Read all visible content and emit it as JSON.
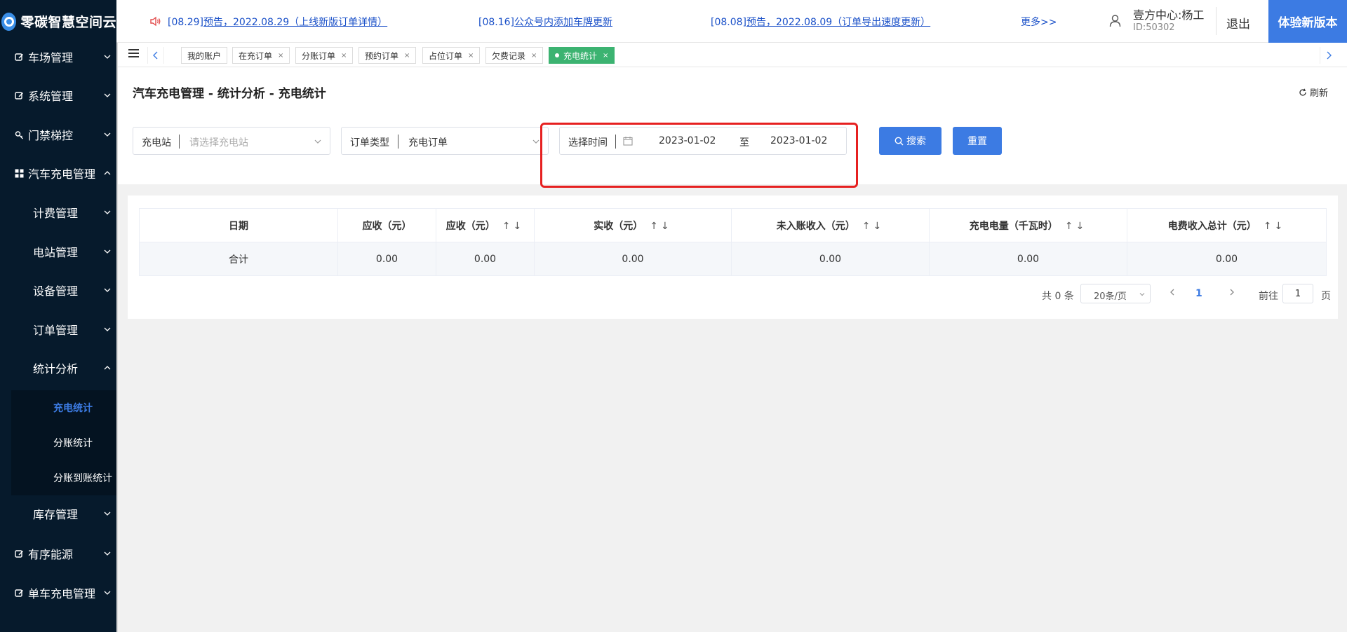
{
  "app": {
    "logo_text": "零碳智慧空间云"
  },
  "header": {
    "notices": [
      {
        "prefix": "[08.29]",
        "text": "预告，2022.08.29（上线新版订单详情）"
      },
      {
        "prefix": "[08.16]",
        "text": "公众号内添加车牌更新"
      },
      {
        "prefix": "[08.08]",
        "text": "预告，2022.08.09（订单导出速度更新）"
      }
    ],
    "more": "更多>>",
    "user_name": "壹方中心:杨工",
    "user_id": "ID:50302",
    "logout": "退出",
    "new_version": "体验新版本"
  },
  "sidebar": {
    "items": [
      {
        "label": "车场管理",
        "icon": "edit-icon",
        "expanded": false
      },
      {
        "label": "系统管理",
        "icon": "edit-icon",
        "expanded": false
      },
      {
        "label": "门禁梯控",
        "icon": "key-icon",
        "expanded": false
      },
      {
        "label": "汽车充电管理",
        "icon": "grid-icon",
        "expanded": true
      },
      {
        "label": "计费管理",
        "expanded": false
      },
      {
        "label": "电站管理",
        "expanded": false
      },
      {
        "label": "设备管理",
        "expanded": false
      },
      {
        "label": "订单管理",
        "expanded": false
      },
      {
        "label": "统计分析",
        "expanded": true
      },
      {
        "label": "库存管理",
        "expanded": false
      },
      {
        "label": "有序能源",
        "icon": "edit-icon",
        "expanded": false
      },
      {
        "label": "单车充电管理",
        "icon": "edit-icon",
        "expanded": false
      }
    ],
    "sub_items": [
      {
        "label": "充电统计",
        "active": true
      },
      {
        "label": "分账统计",
        "active": false
      },
      {
        "label": "分账到账统计",
        "active": false
      }
    ]
  },
  "tabs": [
    {
      "label": "我的账户",
      "closable": false
    },
    {
      "label": "在充订单",
      "closable": true
    },
    {
      "label": "分账订单",
      "closable": true
    },
    {
      "label": "预约订单",
      "closable": true
    },
    {
      "label": "占位订单",
      "closable": true
    },
    {
      "label": "欠费记录",
      "closable": true
    },
    {
      "label": "充电统计",
      "closable": true,
      "active": true
    }
  ],
  "page": {
    "title": "汽车充电管理 - 统计分析 - 充电统计",
    "refresh": "刷新"
  },
  "filters": {
    "station_label": "充电站",
    "station_placeholder": "请选择充电站",
    "order_type_label": "订单类型",
    "order_type_value": "充电订单",
    "time_label": "选择时间",
    "start_date": "2023-01-02",
    "date_sep": "至",
    "end_date": "2023-01-02",
    "search": "搜索",
    "reset": "重置"
  },
  "table": {
    "columns": [
      {
        "label": "日期",
        "sortable": false
      },
      {
        "label": "应收（元）",
        "sortable": false
      },
      {
        "label": "应收（元）",
        "sortable": true
      },
      {
        "label": "实收（元）",
        "sortable": true
      },
      {
        "label": "未入账收入（元）",
        "sortable": true
      },
      {
        "label": "充电电量（千瓦时）",
        "sortable": true
      },
      {
        "label": "电费收入总计（元）",
        "sortable": true
      }
    ],
    "rows": [
      [
        "合计",
        "0.00",
        "0.00",
        "0.00",
        "0.00",
        "0.00",
        "0.00"
      ]
    ],
    "sort_glyph": "↑↓"
  },
  "pagination": {
    "total": "共 0 条",
    "page_size": "20条/页",
    "current_page": "1",
    "goto_label": "前往",
    "goto_value": "1",
    "page_unit": "页"
  },
  "colors": {
    "sidebar_bg": "#061a2c",
    "accent": "#3c7be3",
    "active_tab": "#3cb371",
    "highlight": "#e62020",
    "notice_link": "#1a50c8"
  }
}
